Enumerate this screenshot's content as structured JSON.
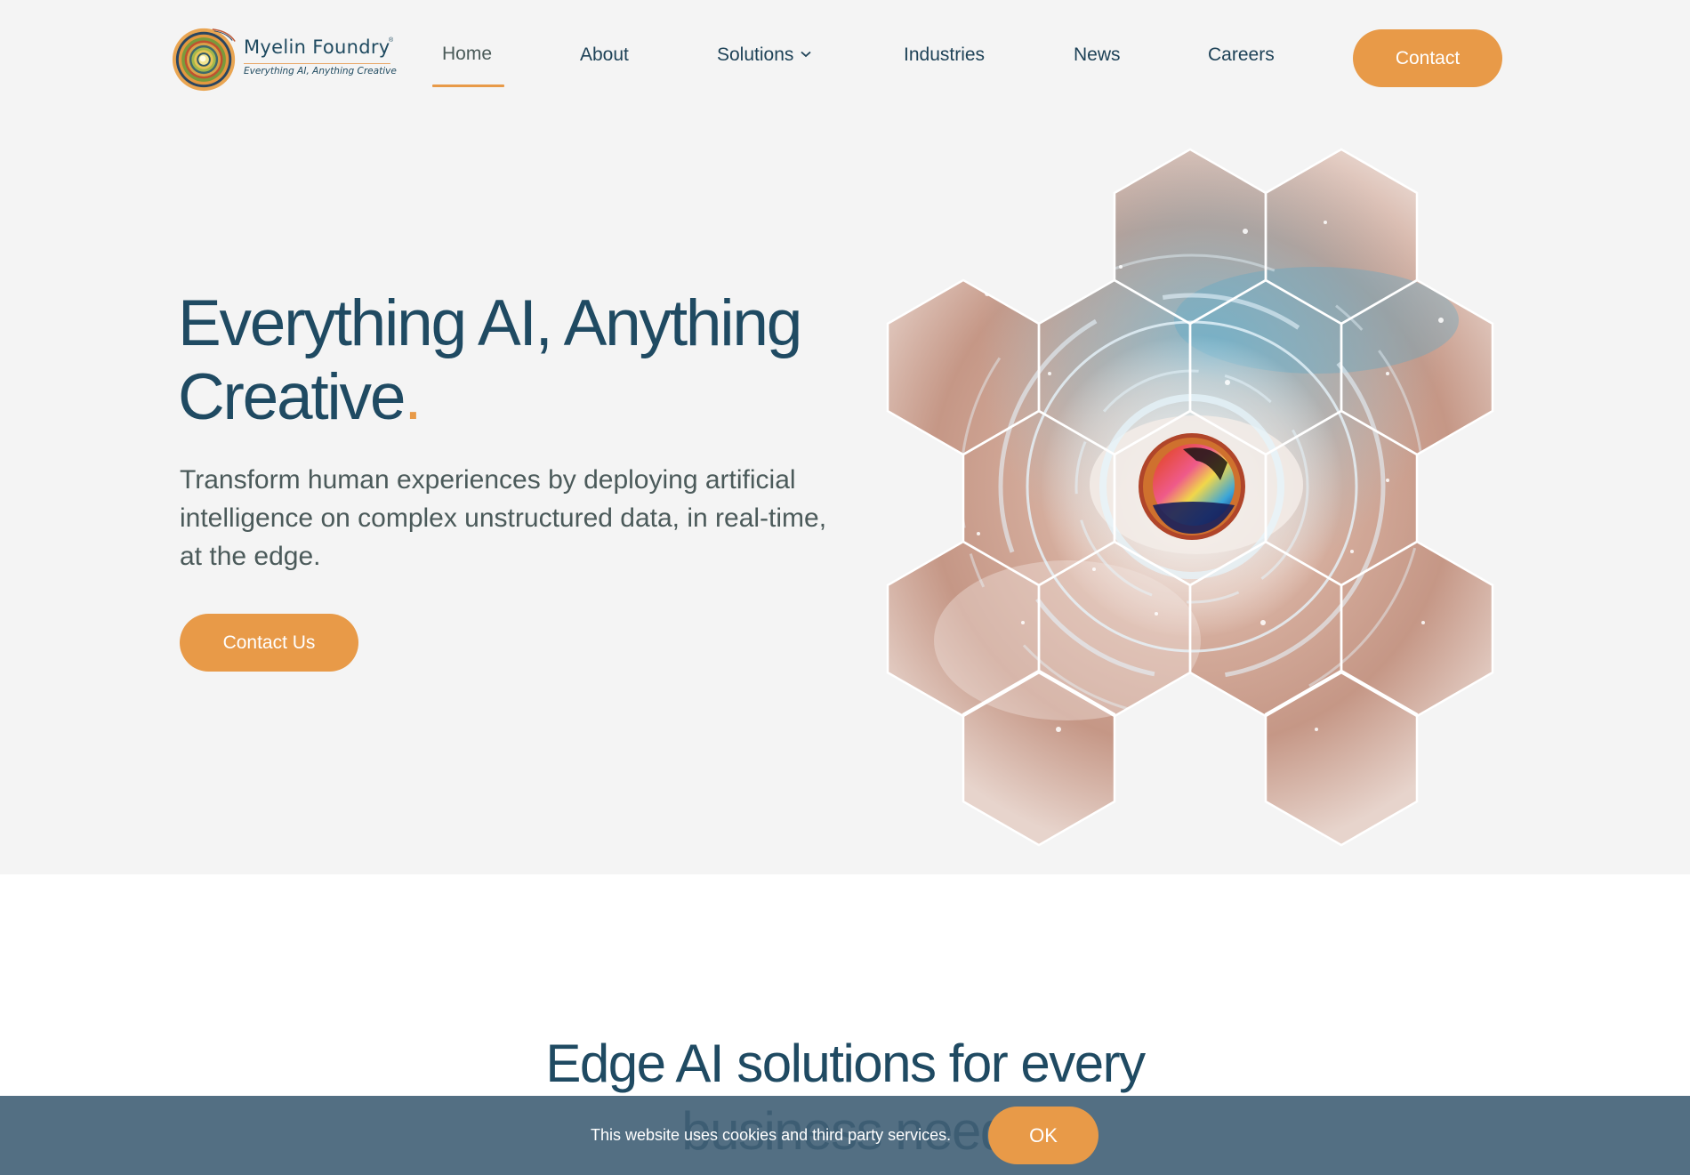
{
  "brand": {
    "name": "Myelin Foundry",
    "registered_mark": "®",
    "tagline": "Everything AI, Anything Creative",
    "logo_icon": "spiral-logo-icon"
  },
  "nav": {
    "items": [
      {
        "label": "Home",
        "active": true
      },
      {
        "label": "About"
      },
      {
        "label": "Solutions",
        "has_dropdown": true,
        "dropdown_icon": "chevron-down-icon"
      },
      {
        "label": "Industries"
      },
      {
        "label": "News"
      },
      {
        "label": "Careers"
      }
    ],
    "contact_label": "Contact"
  },
  "hero": {
    "title_line1": "Everything AI, Anything",
    "title_line2": "Creative",
    "title_dot": ".",
    "subtitle": "Transform human experiences by deploying artificial intelligence on complex unstructured data, in real-time, at the edge.",
    "cta_label": "Contact Us",
    "image_description": "Honeycomb hexagon collage of a human eye with futuristic HUD rings and a rainbow iris"
  },
  "solutions_section": {
    "title_line1": "Edge AI solutions for every",
    "title_line2": "business need"
  },
  "cookie_banner": {
    "message": "This website uses cookies and third party services.",
    "ok_label": "OK"
  },
  "colors": {
    "accent_orange": "#e89a48",
    "navy_text": "#1f4a62",
    "hero_background": "#f4f4f4",
    "cookie_background": "#526e82"
  }
}
